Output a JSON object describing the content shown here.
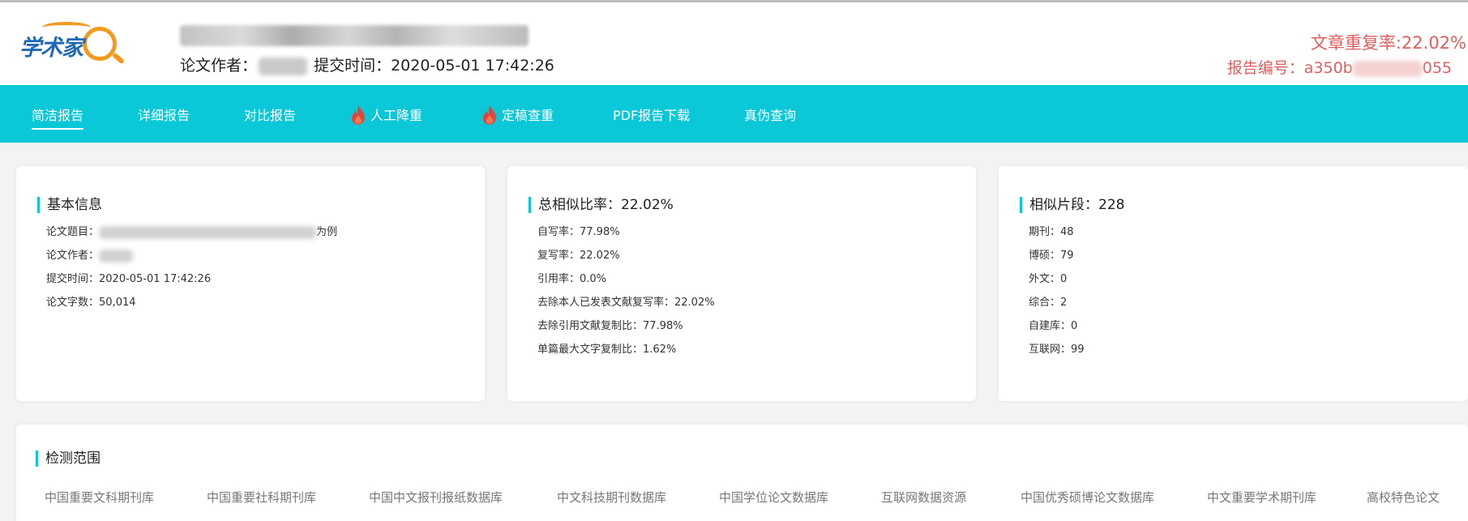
{
  "header": {
    "logo_text": "学术家",
    "author_label": "论文作者：",
    "submit_label": "提交时间：",
    "submit_time": "2020-05-01 17:42:26",
    "repeat_rate_label": "文章重复率:",
    "repeat_rate_value": "22.02%",
    "report_no_label": "报告编号：",
    "report_no_prefix": "a350b",
    "report_no_suffix": "055"
  },
  "nav": {
    "items": [
      {
        "label": "简洁报告",
        "active": true
      },
      {
        "label": "详细报告"
      },
      {
        "label": "对比报告"
      },
      {
        "label": "人工降重",
        "icon": "fire-icon"
      },
      {
        "label": "定稿查重",
        "icon": "fire-icon"
      },
      {
        "label": "PDF报告下载"
      },
      {
        "label": "真伪查询"
      }
    ]
  },
  "basic_info": {
    "title": "基本信息",
    "paper_title_label": "论文题目：",
    "paper_title_suffix": "为例",
    "author_label": "论文作者：",
    "submit_time_label": "提交时间：",
    "submit_time": "2020-05-01 17:42:26",
    "word_count_label": "论文字数：",
    "word_count": "50,014"
  },
  "similarity": {
    "title": "总相似比率：22.02%",
    "rows": [
      "自写率：77.98%",
      "复写率：22.02%",
      "引用率：0.0%",
      "去除本人已发表文献复写率：22.02%",
      "去除引用文献复制比：77.98%",
      "单篇最大文字复制比：1.62%"
    ]
  },
  "segments": {
    "title": "相似片段：228",
    "rows": [
      "期刊：48",
      "博硕：79",
      "外文：0",
      "综合：2",
      "自建库：0",
      "互联网：99"
    ]
  },
  "scope": {
    "title": "检测范围",
    "items": [
      "中国重要文科期刊库",
      "中国重要社科期刊库",
      "中国中文报刊报纸数据库",
      "中文科技期刊数据库",
      "中国学位论文数据库",
      "互联网数据资源",
      "中国优秀硕博论文数据库",
      "中文重要学术期刊库",
      "高校特色论文"
    ]
  },
  "colors": {
    "accent": "#0bc8d9",
    "alert": "#e25d5d",
    "logo_blue": "#1e68b6",
    "logo_orange": "#f39a1e"
  }
}
